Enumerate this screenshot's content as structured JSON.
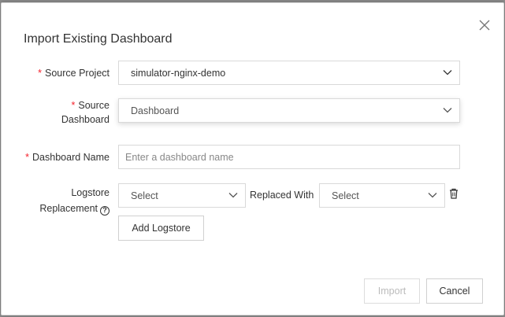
{
  "dialog": {
    "title": "Import Existing Dashboard"
  },
  "form": {
    "source_project": {
      "label": "Source Project",
      "value": "simulator-nginx-demo"
    },
    "source_dashboard": {
      "label_line1": "Source",
      "label_line2": "Dashboard",
      "value": "Dashboard"
    },
    "dashboard_name": {
      "label": "Dashboard Name",
      "placeholder": "Enter a dashboard name"
    },
    "logstore_replacement": {
      "label_line1": "Logstore",
      "label_line2": "Replacement",
      "help_icon": "?",
      "source_value": "Select",
      "replaced_with_label": "Replaced With",
      "target_value": "Select"
    },
    "add_logstore_label": "Add Logstore"
  },
  "footer": {
    "import_label": "Import",
    "cancel_label": "Cancel"
  },
  "colors": {
    "required_asterisk": "#f5222d",
    "border": "#d9d9d9"
  }
}
